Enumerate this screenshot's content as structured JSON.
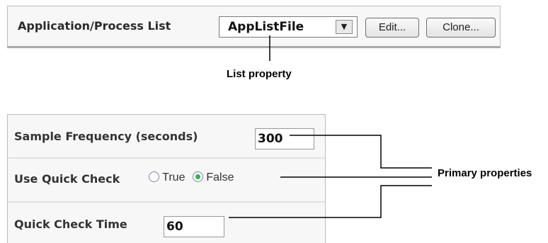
{
  "top_panel": {
    "label": "Application/Process List",
    "select_value": "AppListFile",
    "edit_button": "Edit...",
    "clone_button": "Clone..."
  },
  "callouts": {
    "list_property": "List property",
    "primary_properties": "Primary properties"
  },
  "bottom_panel": {
    "sample_frequency_label": "Sample Frequency (seconds)",
    "sample_frequency_value": "300",
    "quick_check_label": "Use Quick Check",
    "radio_true": "True",
    "radio_false": "False",
    "quick_check_selected": "False",
    "quick_check_time_label": "Quick Check Time",
    "quick_check_time_value": "60"
  }
}
